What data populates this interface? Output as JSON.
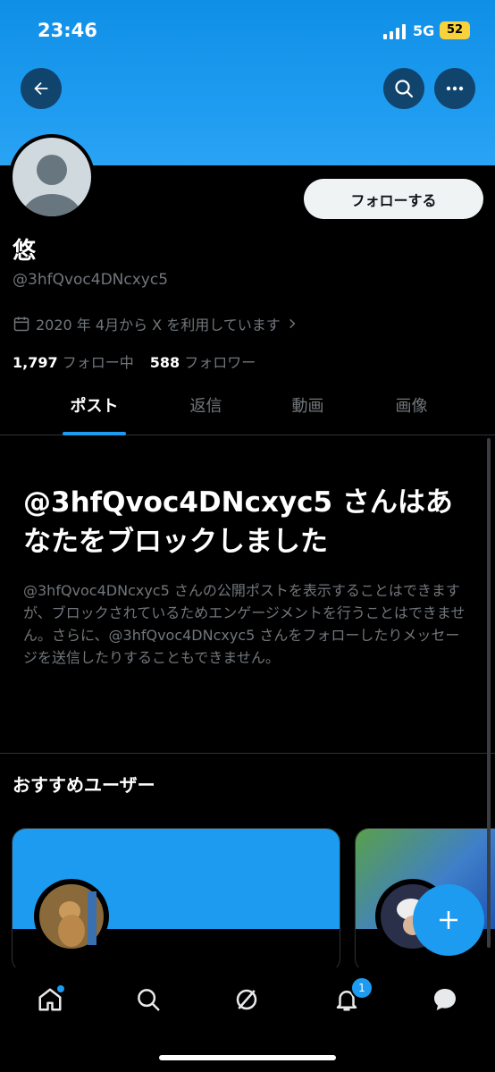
{
  "status_bar": {
    "time": "23:46",
    "network": "5G",
    "battery": "52"
  },
  "profile": {
    "name": "悠",
    "handle": "@3hfQvoc4DNcxyc5",
    "joined": "2020 年 4月から X を利用しています",
    "following_count": "1,797",
    "following_label": "フォロー中",
    "followers_count": "588",
    "followers_label": "フォロワー",
    "follow_button": "フォローする"
  },
  "tabs": [
    {
      "label": "ポスト",
      "active": true
    },
    {
      "label": "返信",
      "active": false
    },
    {
      "label": "動画",
      "active": false
    },
    {
      "label": "画像",
      "active": false
    }
  ],
  "blocked": {
    "title": "@3hfQvoc4DNcxyc5 さんはあなたをブロックしました",
    "body": "@3hfQvoc4DNcxyc5 さんの公開ポストを表示することはできますが、ブロックされているためエンゲージメントを行うことはできません。さらに、@3hfQvoc4DNcxyc5 さんをフォローしたりメッセージを送信したりすることもできません。"
  },
  "recommendations": {
    "title": "おすすめユーザー"
  },
  "notifications_badge": "1",
  "colors": {
    "accent": "#1d9bf0",
    "background": "#000000",
    "muted_text": "#71767b"
  }
}
